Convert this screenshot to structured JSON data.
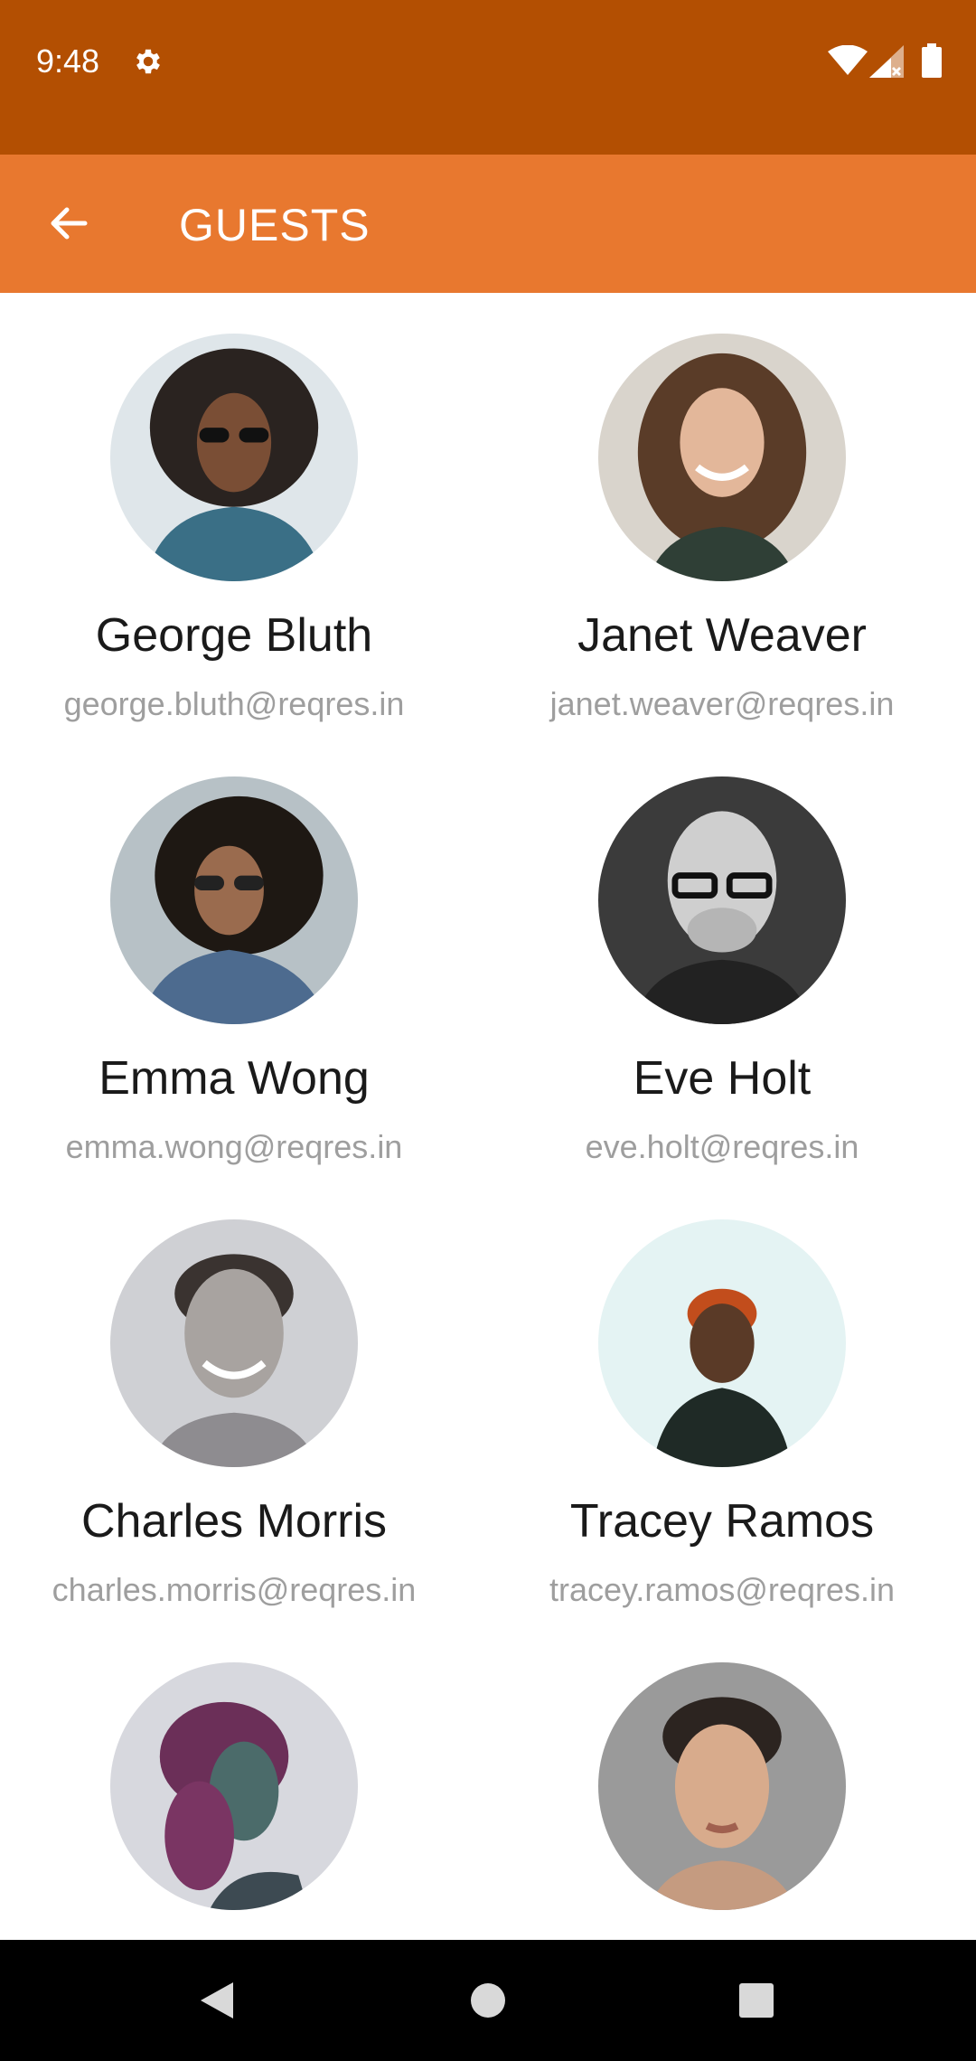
{
  "status_bar": {
    "time": "9:48",
    "icons": [
      "gear-icon",
      "wifi-icon",
      "signal-icon",
      "battery-icon"
    ]
  },
  "app_bar": {
    "title": "GUESTS",
    "back_icon": "arrow-left-icon"
  },
  "guests": [
    {
      "name": "George Bluth",
      "email": "george.bluth@reqres.in"
    },
    {
      "name": "Janet Weaver",
      "email": "janet.weaver@reqres.in"
    },
    {
      "name": "Emma Wong",
      "email": "emma.wong@reqres.in"
    },
    {
      "name": "Eve Holt",
      "email": "eve.holt@reqres.in"
    },
    {
      "name": "Charles Morris",
      "email": "charles.morris@reqres.in"
    },
    {
      "name": "Tracey Ramos",
      "email": "tracey.ramos@reqres.in"
    },
    {
      "name": "",
      "email": ""
    },
    {
      "name": "",
      "email": ""
    }
  ],
  "nav_bar": {
    "icons": [
      "nav-back-icon",
      "nav-home-icon",
      "nav-recents-icon"
    ]
  },
  "colors": {
    "status_bar": "#b34f02",
    "app_bar": "#e8782f",
    "name_text": "#1a1a1a",
    "email_text": "#9e9e9e"
  }
}
